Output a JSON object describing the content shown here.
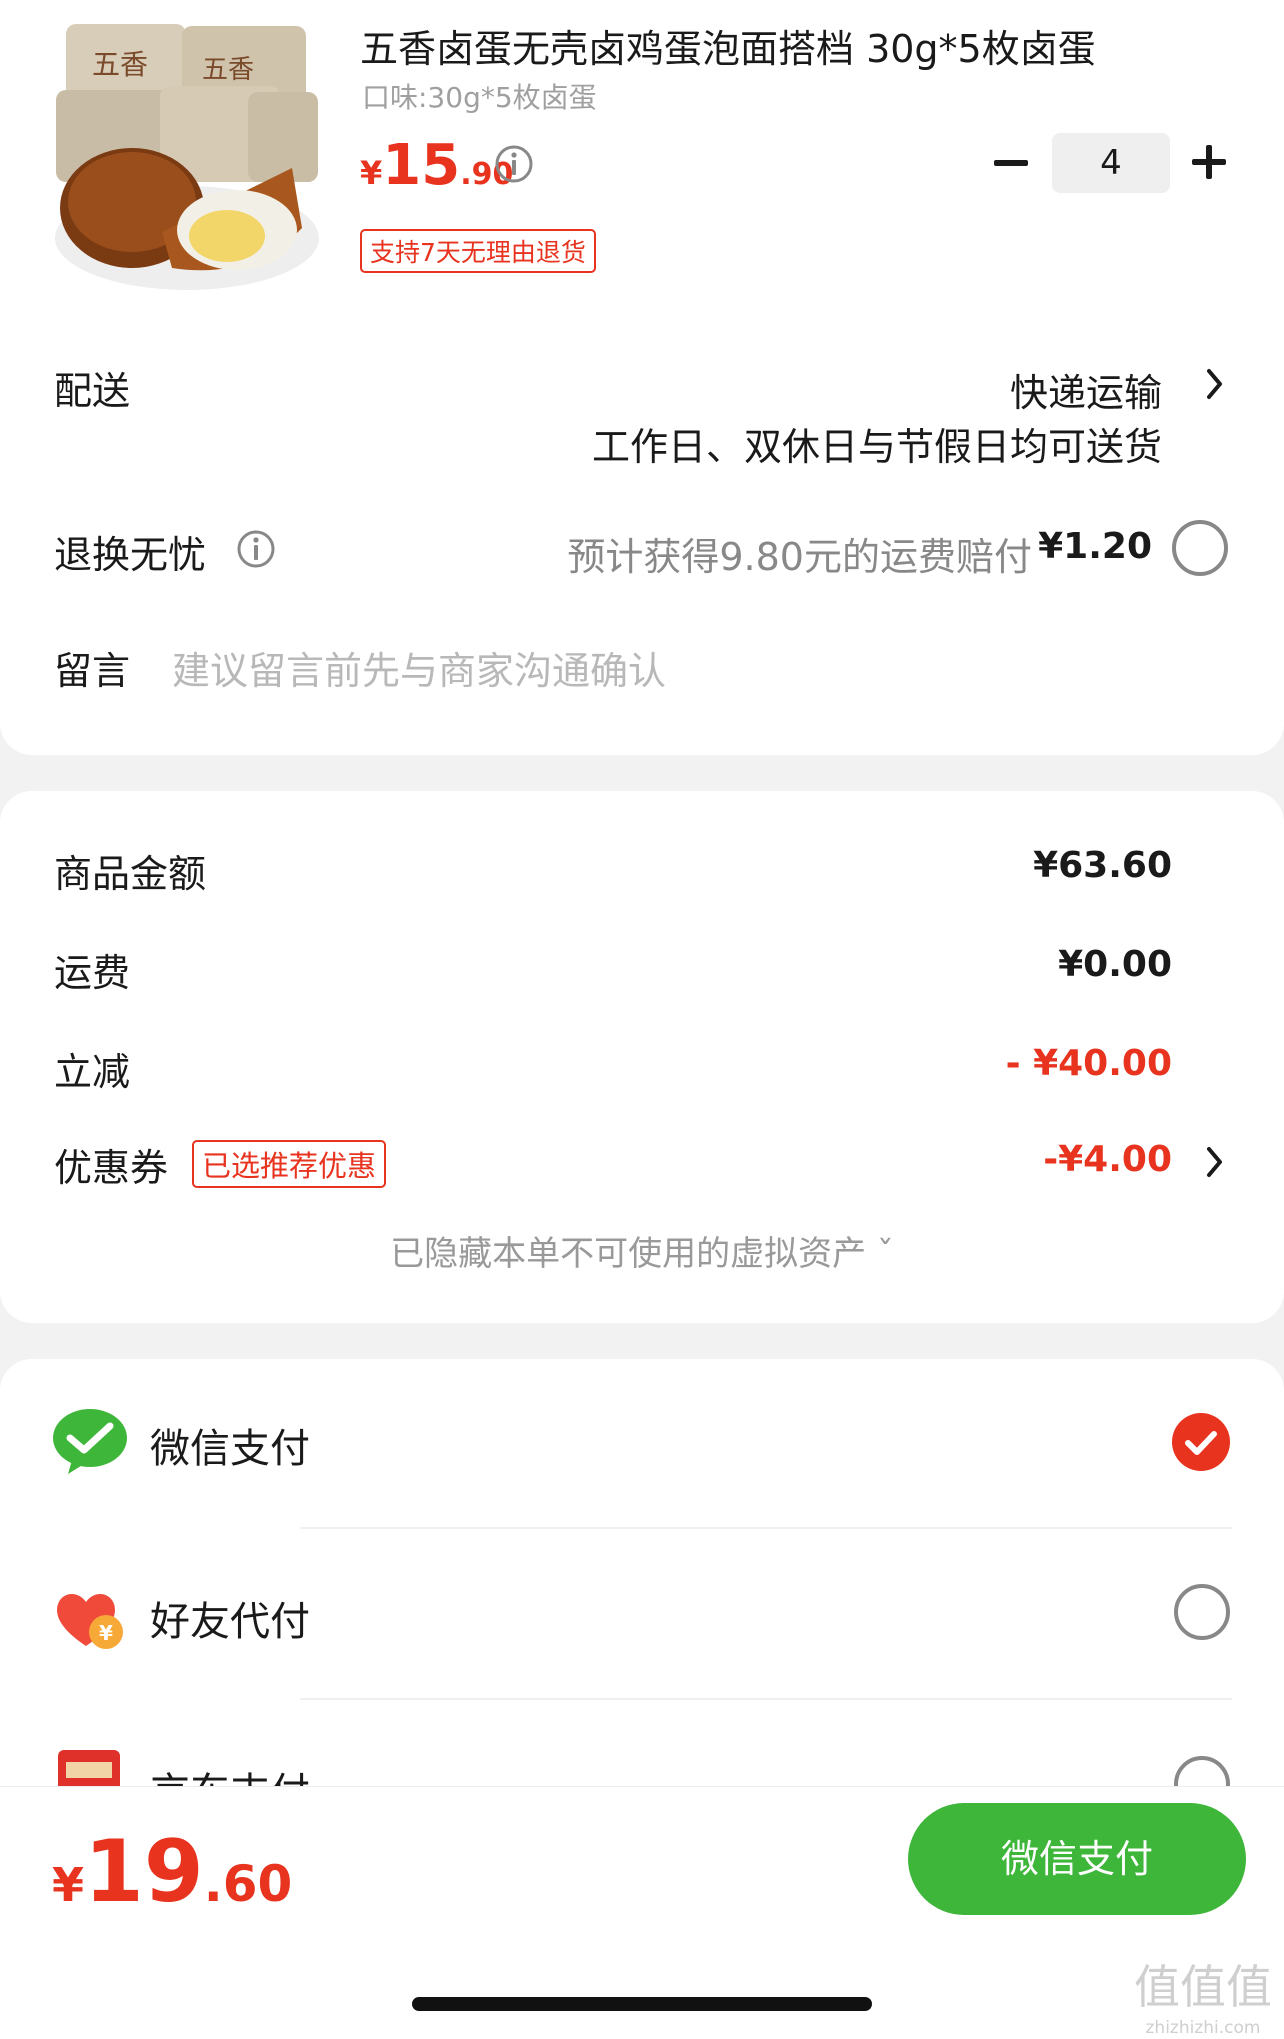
{
  "product": {
    "title": "五香卤蛋无壳卤鸡蛋泡面搭档 30g*5枚卤蛋",
    "flavor": "口味:30g*5枚卤蛋",
    "price_currency": "¥",
    "price_int": "15",
    "price_dec": ".90",
    "return_tag": "支持7天无理由退货",
    "quantity": "4",
    "image_icon": "braised-egg-package-image"
  },
  "delivery": {
    "label": "配送",
    "method": "快递运输",
    "note": "工作日、双休日与节假日均可送货"
  },
  "return_insurance": {
    "label": "退换无忧",
    "desc": "预计获得9.80元的运费赔付",
    "price": "¥1.20",
    "selected": false
  },
  "message": {
    "label": "留言",
    "placeholder": "建议留言前先与商家沟通确认"
  },
  "summary": {
    "goods_label": "商品金额",
    "goods_value": "¥63.60",
    "shipping_label": "运费",
    "shipping_value": "¥0.00",
    "discount_label": "立减",
    "discount_value": "- ¥40.00",
    "coupon_label": "优惠券",
    "coupon_tag": "已选推荐优惠",
    "coupon_value": "-¥4.00",
    "hidden_assets": "已隐藏本单不可使用的虚拟资产 ˇ"
  },
  "payment": {
    "methods": [
      {
        "name": "微信支付",
        "icon": "wechat-pay-icon",
        "selected": true
      },
      {
        "name": "好友代付",
        "icon": "friend-pay-heart-icon",
        "selected": false
      },
      {
        "name": "京东支付",
        "icon": "jd-pay-card-icon",
        "selected": false
      }
    ]
  },
  "footer": {
    "total_currency": "¥",
    "total_int": "19",
    "total_dec": ".60",
    "pay_button": "微信支付"
  },
  "watermark": {
    "text": "值值值",
    "site": "zhizhizhi.com"
  },
  "colors": {
    "accent_red": "#e8331f",
    "wechat_green": "#3eb63a",
    "background": "#f2f2f2"
  }
}
